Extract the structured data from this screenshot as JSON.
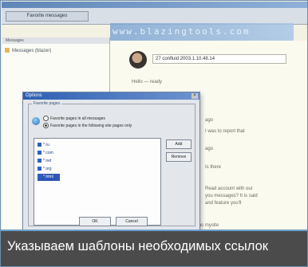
{
  "app": {
    "toolbar_label": "Favorite messages",
    "url_text": "www.blazingtools.com",
    "left_panel_header": "Messages",
    "left_items": [
      "Messages (blazer)"
    ]
  },
  "chat": {
    "header": "27 confluid 2003.1.10.48.14",
    "lines": [
      "Hello — ready",
      "ago",
      "I was to report that",
      "ago",
      "Is there",
      "Read account with our",
      "you messages? It is said",
      "and feature you'll",
      "Your IP/IB browser.. will be known as mysite"
    ]
  },
  "dialog": {
    "title": "Options",
    "close_glyph": "×",
    "group_label": "Favorite pages",
    "radio_1": "Favorite pages in all messages",
    "radio_2": "Favorite pages in the following site pages only",
    "list_items": [
      "*.ru",
      "*.com",
      "*.net",
      "*.org",
      "*.html"
    ],
    "add_label": "Add",
    "delete_label": "Remove",
    "ok_label": "OK",
    "cancel_label": "Cancel"
  },
  "caption": {
    "text": "Указываем шаблоны необходимых ссылок"
  }
}
